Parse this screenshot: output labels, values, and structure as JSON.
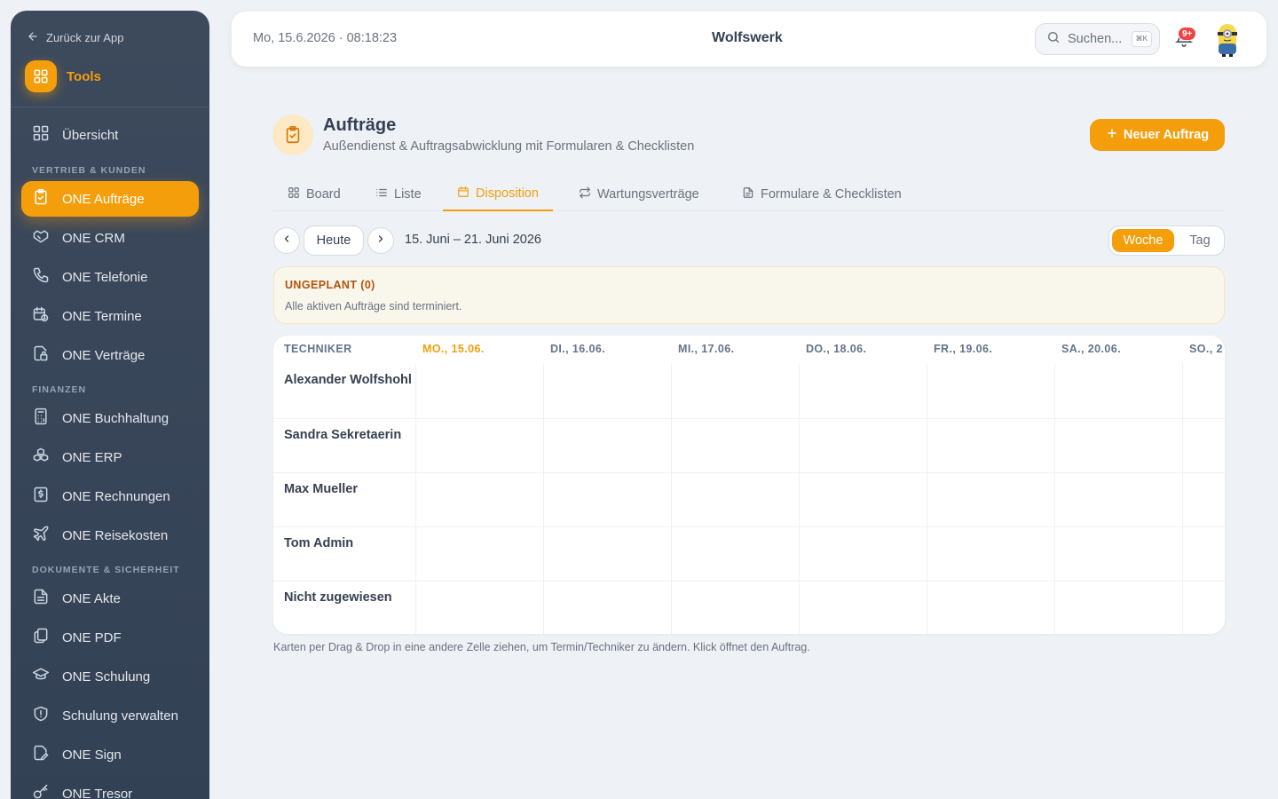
{
  "sidebar": {
    "back_label": "Zurück zur App",
    "tools_label": "Tools",
    "sections": {
      "sales": "VERTRIEB & KUNDEN",
      "finance": "FINANZEN",
      "docs": "DOKUMENTE & SICHERHEIT"
    },
    "items": [
      {
        "label": "Übersicht",
        "icon": "grid-icon"
      },
      {
        "label": "ONE Aufträge",
        "icon": "clipboard-check-icon",
        "active": true
      },
      {
        "label": "ONE CRM",
        "icon": "handshake-icon"
      },
      {
        "label": "ONE Telefonie",
        "icon": "phone-icon"
      },
      {
        "label": "ONE Termine",
        "icon": "calendar-clock-icon"
      },
      {
        "label": "ONE Verträge",
        "icon": "file-lock-icon"
      },
      {
        "label": "ONE Buchhaltung",
        "icon": "calculator-icon"
      },
      {
        "label": "ONE ERP",
        "icon": "boxes-icon"
      },
      {
        "label": "ONE Rechnungen",
        "icon": "receipt-icon"
      },
      {
        "label": "ONE Reisekosten",
        "icon": "plane-icon"
      },
      {
        "label": "ONE Akte",
        "icon": "file-text-icon"
      },
      {
        "label": "ONE PDF",
        "icon": "files-icon"
      },
      {
        "label": "ONE Schulung",
        "icon": "graduation-cap-icon"
      },
      {
        "label": "Schulung verwalten",
        "icon": "shield-icon"
      },
      {
        "label": "ONE Sign",
        "icon": "file-pen-icon"
      },
      {
        "label": "ONE Tresor",
        "icon": "key-icon"
      }
    ]
  },
  "header": {
    "datetime": "Mo, 15.6.2026 · 08:18:23",
    "org": "Wolfswerk",
    "search_placeholder": "Suchen...",
    "search_shortcut": "⌘K",
    "notifications_badge": "9+"
  },
  "page": {
    "title": "Aufträge",
    "subtitle": "Außendienst & Auftragsabwicklung mit Formularen & Checklisten",
    "new_button": "Neuer Auftrag"
  },
  "tabs": [
    {
      "label": "Board",
      "icon": "grid-icon"
    },
    {
      "label": "Liste",
      "icon": "list-icon"
    },
    {
      "label": "Disposition",
      "icon": "calendar-icon",
      "active": true
    },
    {
      "label": "Wartungsverträge",
      "icon": "repeat-icon"
    },
    {
      "label": "Formulare & Checklisten",
      "icon": "file-icon"
    }
  ],
  "controls": {
    "today_label": "Heute",
    "range": "15. Juni – 21. Juni 2026",
    "view_week": "Woche",
    "view_day": "Tag"
  },
  "unplanned": {
    "title": "UNGEPLANT (0)",
    "text": "Alle aktiven Aufträge sind terminiert."
  },
  "schedule": {
    "tech_header": "TECHNIKER",
    "days": [
      "MO., 15.06.",
      "DI., 16.06.",
      "MI., 17.06.",
      "DO., 18.06.",
      "FR., 19.06.",
      "SA., 20.06.",
      "SO., 2"
    ],
    "technicians": [
      "Alexander Wolfshohl",
      "Sandra Sekretaerin",
      "Max Mueller",
      "Tom Admin",
      "Nicht zugewiesen"
    ]
  },
  "hint": "Karten per Drag & Drop in eine andere Zelle ziehen, um Termin/Techniker zu ändern. Klick öffnet den Auftrag.",
  "colors": {
    "accent": "#f59e0b",
    "sidebar": "#3d4a5c",
    "badge": "#ef4444"
  }
}
